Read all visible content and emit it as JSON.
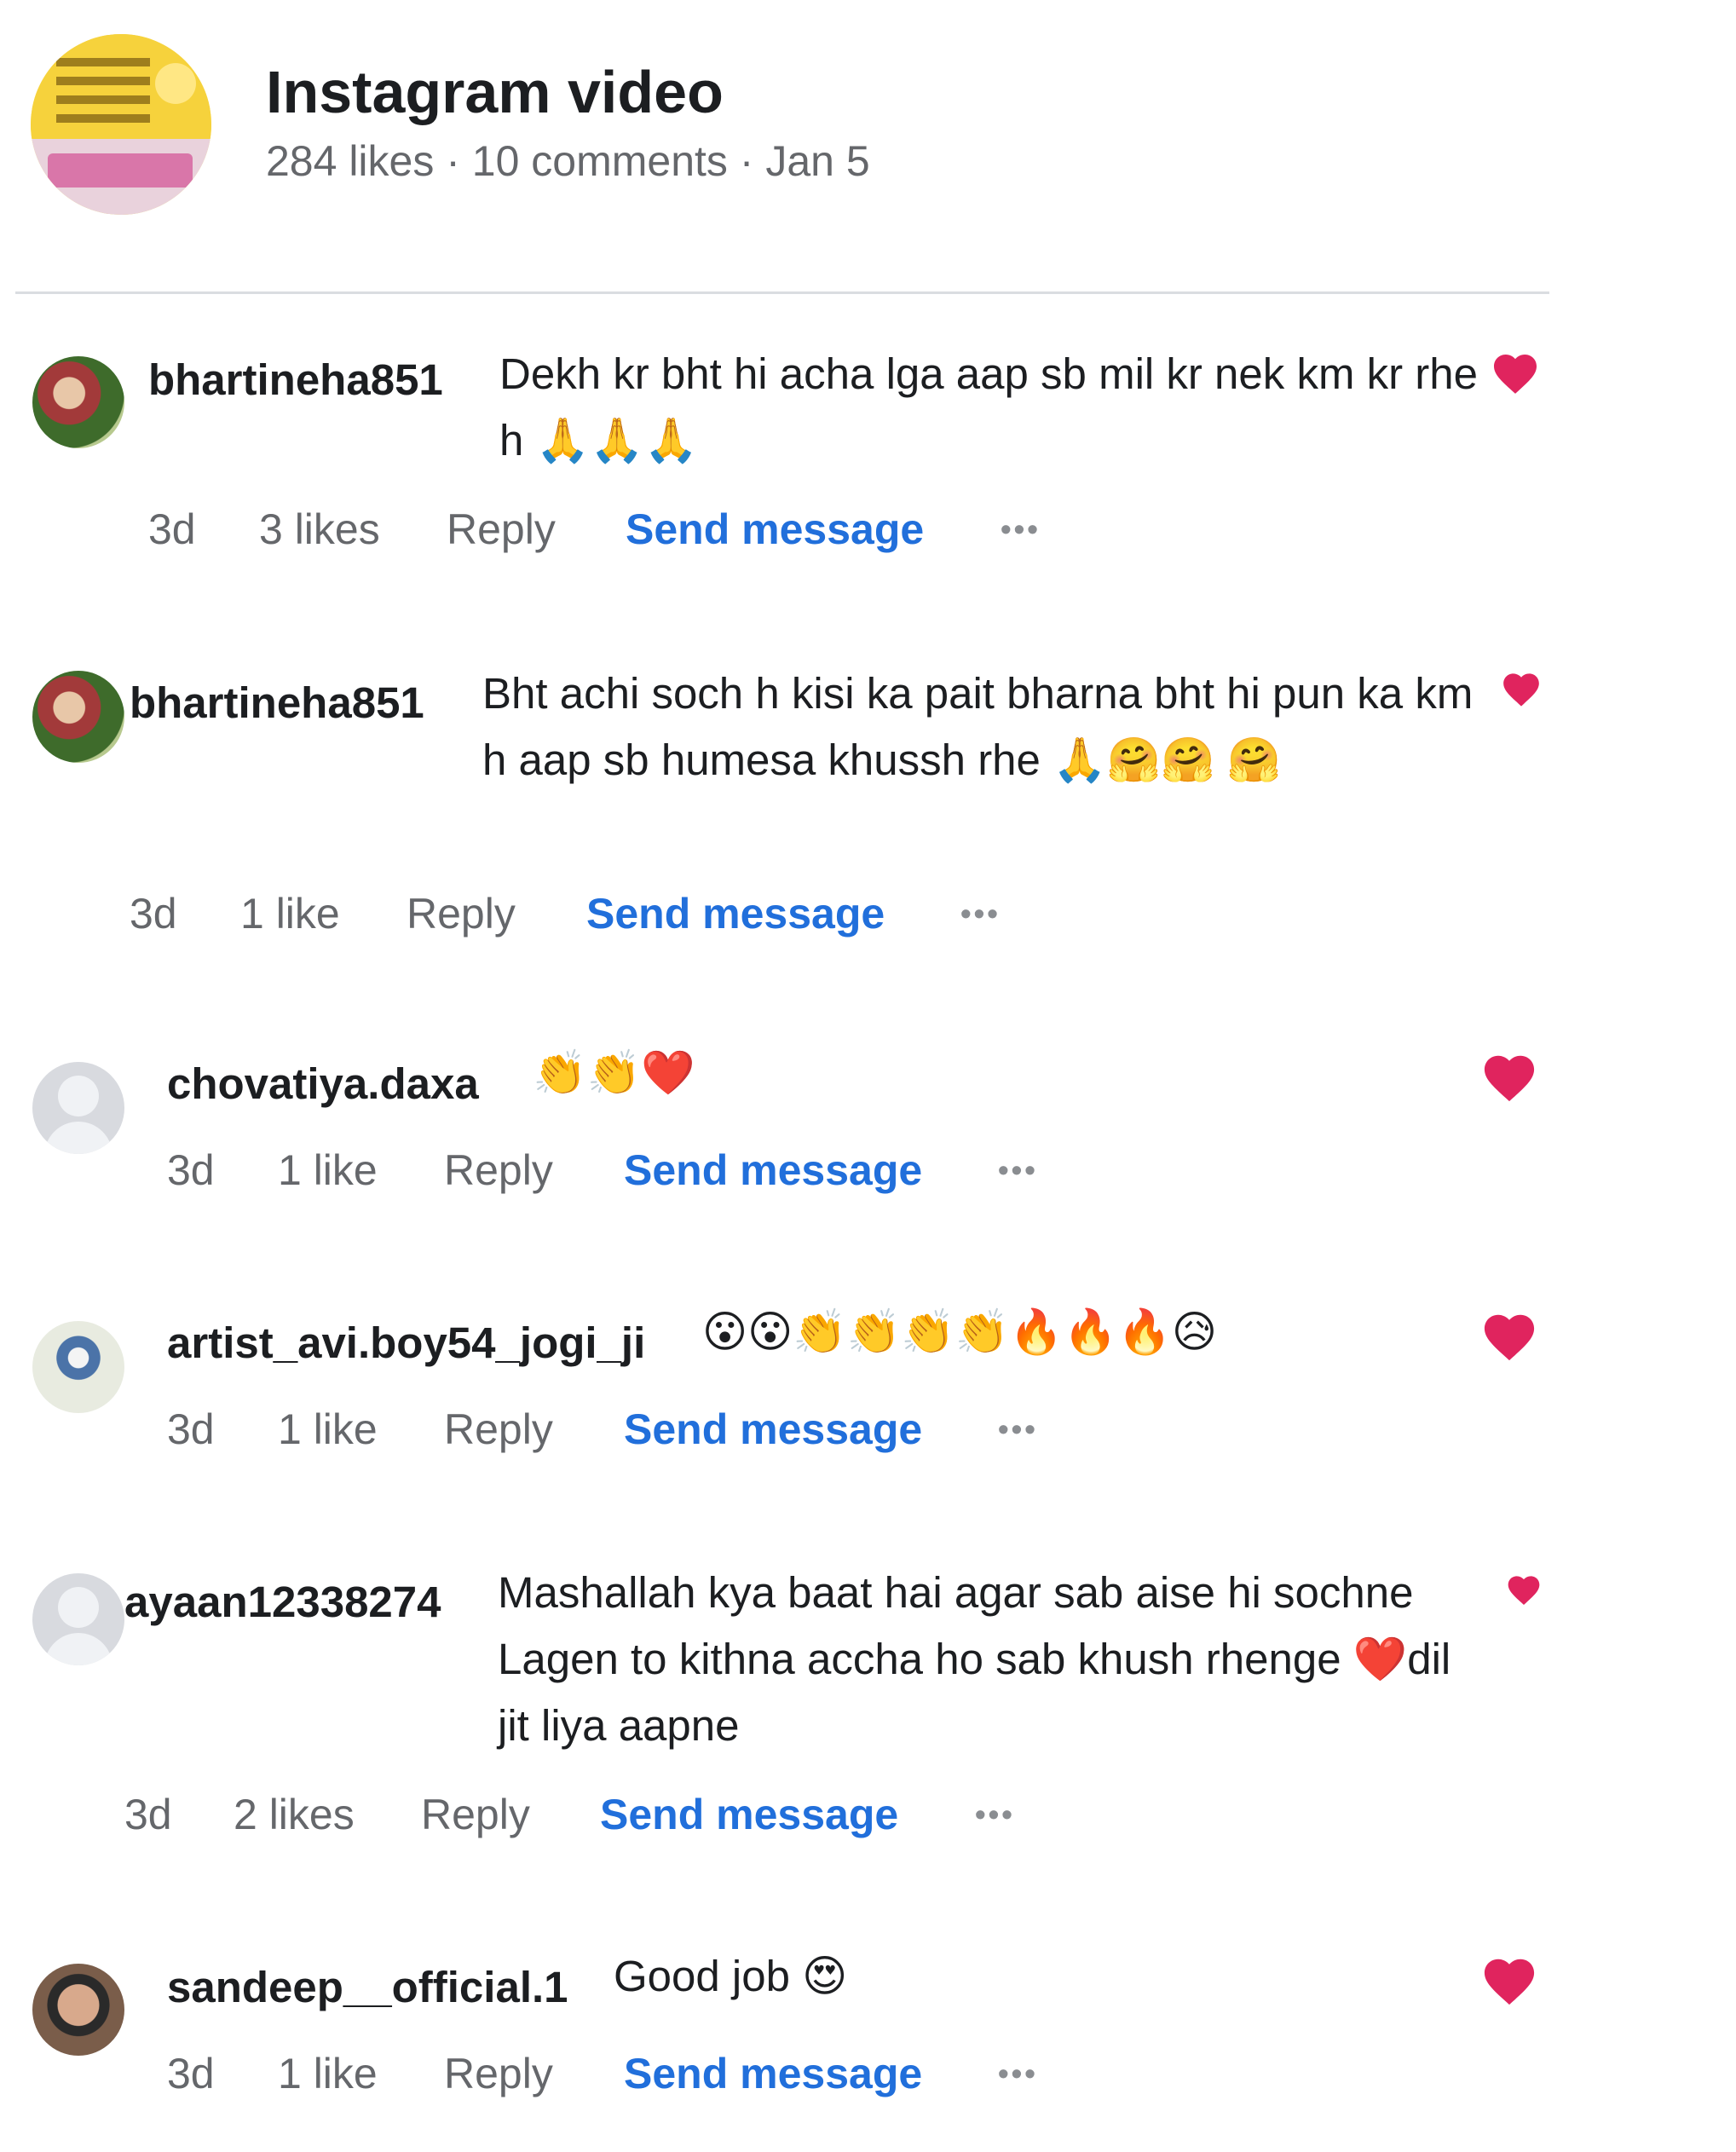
{
  "post": {
    "title": "Instagram video",
    "meta": "284 likes · 10 comments · Jan 5"
  },
  "comments": [
    {
      "username": "bhartineha851",
      "text": "Dekh kr bht hi acha lga aap sb mil kr nek km kr rhe h 🙏🙏🙏",
      "time": "3d",
      "likes": "3 likes",
      "reply": "Reply",
      "send": "Send message",
      "more": "•••"
    },
    {
      "username": "bhartineha851",
      "text": "Bht achi soch h kisi ka pait bharna bht hi pun ka km h aap sb humesa khussh rhe 🙏🤗🤗 🤗",
      "time": "3d",
      "likes": "1 like",
      "reply": "Reply",
      "send": "Send message",
      "more": "•••"
    },
    {
      "username": "chovatiya.daxa",
      "text": "👏👏❤️",
      "time": "3d",
      "likes": "1 like",
      "reply": "Reply",
      "send": "Send message",
      "more": "•••"
    },
    {
      "username": "artist_avi.boy54_jogi_ji",
      "text": "😮😮👏👏👏👏🔥🔥🔥😥",
      "time": "3d",
      "likes": "1 like",
      "reply": "Reply",
      "send": "Send message",
      "more": "•••"
    },
    {
      "username": "ayaan12338274",
      "text": "Mashallah kya baat hai agar sab aise hi sochne Lagen to kithna accha ho sab khush rhenge ❤️dil jit liya aapne",
      "time": "3d",
      "likes": "2 likes",
      "reply": "Reply",
      "send": "Send message",
      "more": "•••"
    },
    {
      "username": "sandeep__official.1",
      "text": "Good job 😍",
      "time": "3d",
      "likes": "1 like",
      "reply": "Reply",
      "send": "Send message",
      "more": "•••"
    }
  ],
  "colors": {
    "heart": "#e0245e",
    "link": "#216fdb",
    "muted": "#65676b"
  }
}
